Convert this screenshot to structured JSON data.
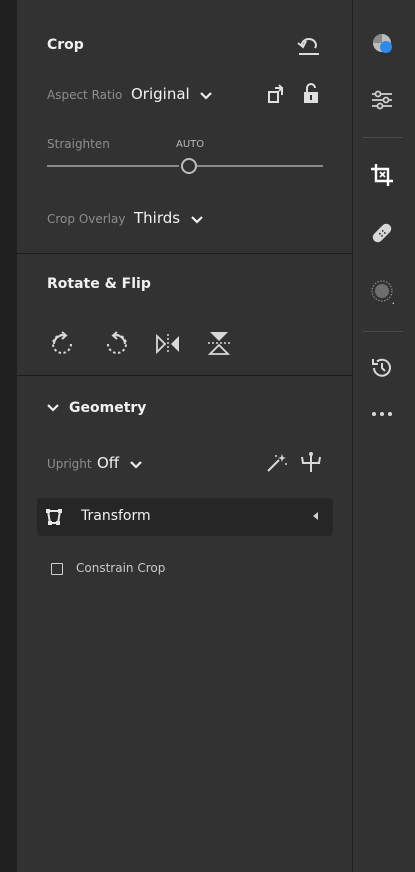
{
  "crop": {
    "title": "Crop",
    "aspect_ratio_label": "Aspect Ratio",
    "aspect_ratio_value": "Original",
    "straighten_label": "Straighten",
    "straighten_auto": "AUTO",
    "straighten_level": 0.5,
    "overlay_label": "Crop Overlay",
    "overlay_value": "Thirds"
  },
  "rotate": {
    "title": "Rotate & Flip"
  },
  "geometry": {
    "title": "Geometry",
    "upright_label": "Upright",
    "upright_value": "Off",
    "transform_label": "Transform",
    "constrain_label": "Constrain Crop",
    "constrain_checked": false
  },
  "rail": {
    "icons": [
      "color-swatch-icon",
      "sliders-icon",
      "crop-icon",
      "bandage-icon",
      "masking-icon",
      "history-icon",
      "more-icon"
    ],
    "active": "crop-icon",
    "accent": "#2d8ceb"
  }
}
